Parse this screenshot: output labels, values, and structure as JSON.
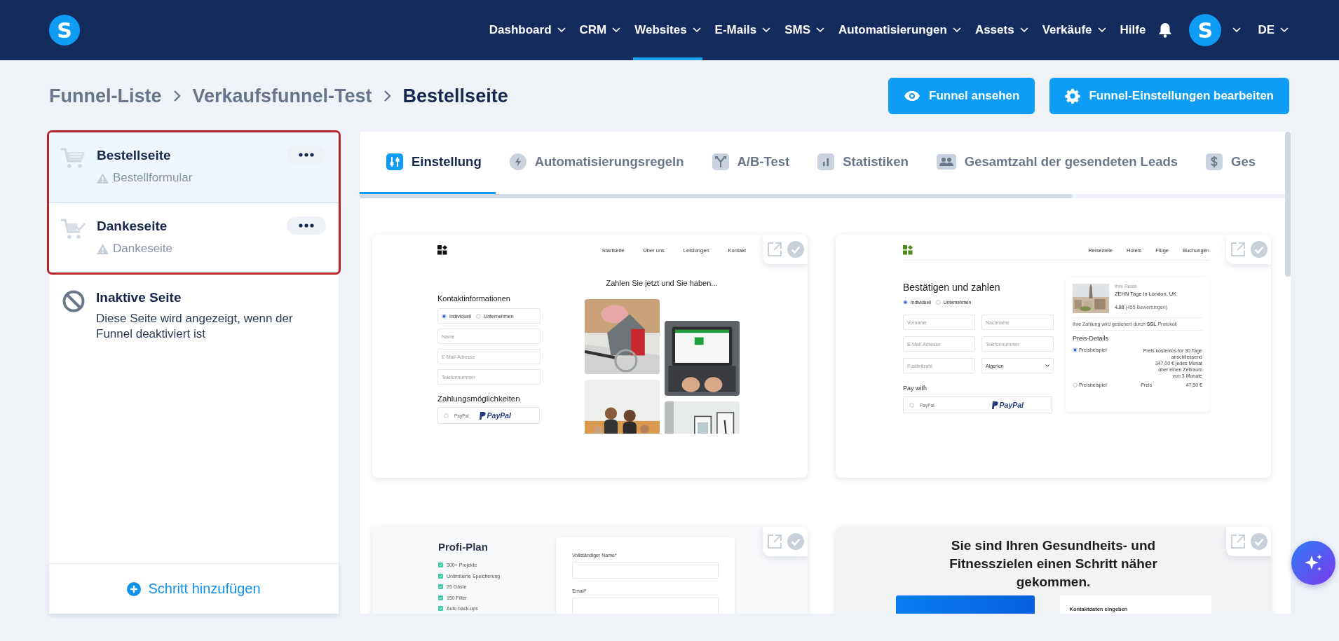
{
  "header": {
    "logo": "S",
    "nav": [
      {
        "label": "Dashboard",
        "dropdown": true,
        "selected": false
      },
      {
        "label": "CRM",
        "dropdown": true,
        "selected": false
      },
      {
        "label": "Websites",
        "dropdown": true,
        "selected": true
      },
      {
        "label": "E-Mails",
        "dropdown": true,
        "selected": false
      },
      {
        "label": "SMS",
        "dropdown": true,
        "selected": false
      },
      {
        "label": "Automatisierungen",
        "dropdown": true,
        "selected": false
      },
      {
        "label": "Assets",
        "dropdown": true,
        "selected": false
      },
      {
        "label": "Verkäufe",
        "dropdown": true,
        "selected": false
      },
      {
        "label": "Hilfe",
        "dropdown": false,
        "selected": false
      }
    ],
    "avatar": "S",
    "language": "DE"
  },
  "breadcrumb": [
    {
      "label": "Funnel-Liste",
      "current": false
    },
    {
      "label": "Verkaufsfunnel-Test",
      "current": false
    },
    {
      "label": "Bestellseite",
      "current": true
    }
  ],
  "actions": [
    {
      "label": "Funnel ansehen"
    },
    {
      "label": "Funnel-Einstellungen bearbeiten"
    }
  ],
  "steps": [
    {
      "title": "Bestellseite",
      "subtitle": "Bestellformular",
      "selected": true
    },
    {
      "title": "Dankeseite",
      "subtitle": "Dankeseite",
      "selected": false
    }
  ],
  "inactive_step": {
    "title": "Inaktive Seite",
    "text": "Diese Seite wird angezeigt, wenn der Funnel deaktiviert ist"
  },
  "add_step": "Schritt hinzufügen",
  "tabs": [
    {
      "label": "Einstellung",
      "selected": true
    },
    {
      "label": "Automatisierungsregeln",
      "selected": false
    },
    {
      "label": "A/B-Test",
      "selected": false
    },
    {
      "label": "Statistiken",
      "selected": false
    },
    {
      "label": "Gesamtzahl der gesendeten Leads",
      "selected": false
    },
    {
      "label": "Ges",
      "selected": false
    }
  ],
  "templates": [
    {
      "kind": "order-form",
      "nav": [
        "Startseite",
        "Über uns",
        "Leistungen",
        "Kontakt"
      ],
      "heading": "Kontaktinformationen",
      "options": [
        {
          "label": "Individuell",
          "selected": true
        },
        {
          "label": "Unternehmen",
          "selected": false
        }
      ],
      "fields": [
        "Name",
        "E-Mail-Adresse",
        "Telefonnummer"
      ],
      "payment_heading": "Zahlungsmöglichkeiten",
      "payment": {
        "label": "PayPal",
        "logo": "PayPal",
        "selected": false
      },
      "gallery_heading": "Zahlen Sie jetzt und Sie haben...",
      "gallery": [
        {
          "kind": "picture"
        },
        {
          "kind": "picture"
        },
        {
          "kind": "picture"
        },
        {
          "kind": "picture"
        }
      ]
    },
    {
      "kind": "checkout",
      "nav": [
        "Reiseziele",
        "Hotels",
        "Flüge",
        "Buchungen"
      ],
      "heading": "Bestätigen und zahlen",
      "options": [
        {
          "label": "Individuell",
          "selected": true
        },
        {
          "label": "Unternehmen",
          "selected": false
        }
      ],
      "fields": [
        "Vorname",
        "Nachname",
        "E-Mail-Adresse",
        "Telefonnummer",
        "Postleitzahl"
      ],
      "select": "Algerien",
      "payment_heading": "Pay with",
      "payment": {
        "label": "PayPal",
        "logo": "PayPal",
        "selected": false
      },
      "summary": {
        "eyebrow": "Ihre Reise",
        "title": "ZEHN Tage in London, UK",
        "rating": "**4.88** (455 Bewertungen)",
        "security": "Ihre Zahlung wird gesichert durch **SSL** Protokoll",
        "price_heading": "Preis-Details",
        "prices": [
          {
            "label": "Preisbeispiel",
            "selected": true,
            "detail_lines": [
              "Preis kostenlos für 30 Tage",
              "anschliessend",
              "347,00 € jedes Monat",
              "über einen Zeitraum",
              "von 3 Monate"
            ]
          },
          {
            "label": "Preisbeispiel",
            "selected": false,
            "column": "Preis",
            "amount": "47,50 €"
          }
        ]
      }
    },
    {
      "kind": "plan",
      "title": "Profi-Plan",
      "features": [
        "300+ Projekte",
        "Unlimitierte Speicherung",
        "25 Gäste",
        "150 Filter",
        "Auto back-ups"
      ],
      "form_fields": [
        "Vollständiger Name*",
        "Email*"
      ]
    },
    {
      "kind": "fitness",
      "heading": "Sie sind Ihren Gesundheits- und Fitnesszielen einen Schritt näher gekommen.",
      "form_title": "Kontaktdaten eingeben"
    }
  ]
}
